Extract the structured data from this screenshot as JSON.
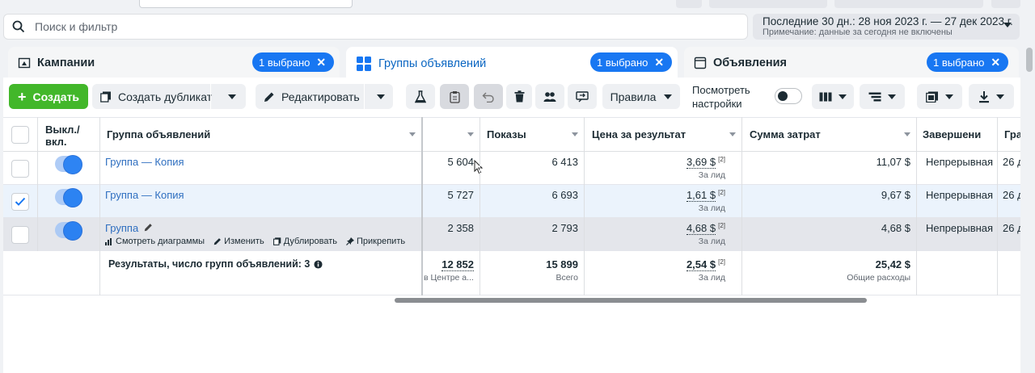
{
  "search": {
    "placeholder": "Поиск и фильтр"
  },
  "date_range": {
    "label": "Последние 30 дн.: 28 ноя 2023 г. — 27 дек 2023 г.",
    "note": "Примечание: данные за сегодня не включены"
  },
  "tabs": [
    {
      "label": "Кампании",
      "selected": "1 выбрано"
    },
    {
      "label": "Группы объявлений",
      "selected": "1 выбрано"
    },
    {
      "label": "Объявления",
      "selected": "1 выбрано"
    }
  ],
  "toolbar": {
    "create": "Создать",
    "duplicate": "Создать дубликат",
    "edit": "Редактировать",
    "rules": "Правила",
    "view_settings_line1": "Посмотреть",
    "view_settings_line2": "настройки"
  },
  "columns": {
    "onoff_line1": "Выкл./",
    "onoff_line2": "вкл.",
    "adset": "Группа объявлений",
    "impressions": "Показы",
    "cost_per_result": "Цена за результат",
    "amount_spent": "Сумма затрат",
    "ends": "Завершени",
    "schedule": "Гра"
  },
  "rows": [
    {
      "name": "Группа — Копия",
      "reach": "5 604",
      "impressions": "6 413",
      "cost": "3,69 $",
      "cost_sup": "[2]",
      "cost_sub": "За лид",
      "spent": "11,07 $",
      "ends": "Непрерывная",
      "schedule": "26 д",
      "checked": false
    },
    {
      "name": "Группа — Копия",
      "reach": "5 727",
      "impressions": "6 693",
      "cost": "1,61 $",
      "cost_sup": "[2]",
      "cost_sub": "За лид",
      "spent": "9,67 $",
      "ends": "Непрерывная",
      "schedule": "26 д",
      "checked": true
    },
    {
      "name": "Группа",
      "reach": "2 358",
      "impressions": "2 793",
      "cost": "4,68 $",
      "cost_sup": "[2]",
      "cost_sub": "За лид",
      "spent": "4,68 $",
      "ends": "Непрерывная",
      "schedule": "26 д",
      "checked": false
    }
  ],
  "row_actions": {
    "charts": "Смотреть диаграммы",
    "edit": "Изменить",
    "duplicate": "Дублировать",
    "pin": "Прикрепить"
  },
  "totals": {
    "label": "Результаты, число групп объявлений: 3",
    "reach": "12 852",
    "reach_sub": "в Центре а...",
    "impressions": "15 899",
    "impressions_sub": "Всего",
    "cost": "2,54 $",
    "cost_sup": "[2]",
    "cost_sub": "За лид",
    "spent": "25,42 $",
    "spent_sub": "Общие расходы"
  },
  "colors": {
    "accent": "#1877f2",
    "create_green": "#42b72a",
    "link": "#2f6fc0"
  }
}
